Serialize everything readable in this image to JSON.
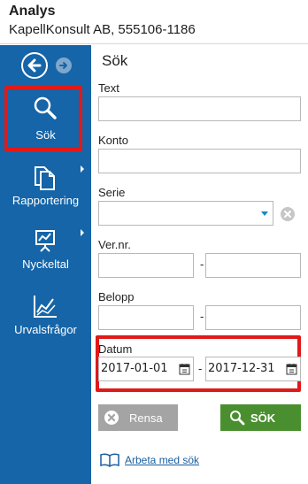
{
  "window": {
    "title": "Analys",
    "company": "KapellKonsult AB, 555106-1186"
  },
  "sidebar": {
    "back_icon": "arrow-left-circle-icon",
    "forward_icon": "arrow-right-circle-icon",
    "items": [
      {
        "label": "Sök",
        "icon": "search-icon",
        "selected": true
      },
      {
        "label": "Rapportering",
        "icon": "document-icon",
        "has_submenu": true
      },
      {
        "label": "Nyckeltal",
        "icon": "presentation-chart-icon",
        "has_submenu": true
      },
      {
        "label": "Urvalsfrågor",
        "icon": "line-chart-icon"
      }
    ]
  },
  "panel": {
    "title": "Sök",
    "fields": {
      "text": {
        "label": "Text",
        "value": ""
      },
      "konto": {
        "label": "Konto",
        "value": ""
      },
      "serie": {
        "label": "Serie",
        "value": ""
      },
      "vernr": {
        "label": "Ver.nr.",
        "from": "",
        "to": ""
      },
      "belopp": {
        "label": "Belopp",
        "from": "",
        "to": ""
      },
      "datum": {
        "label": "Datum",
        "from": "2017-01-01",
        "to": "2017-12-31"
      }
    },
    "range_separator": "-",
    "clear_button": "Rensa",
    "search_button": "SÖK",
    "help_link": "Arbeta med sök"
  },
  "colors": {
    "sidebar": "#1565a8",
    "highlight": "#e01919",
    "search_button": "#4a8f2f",
    "clear_button": "#a4a4a4",
    "link": "#1a5ea0"
  }
}
